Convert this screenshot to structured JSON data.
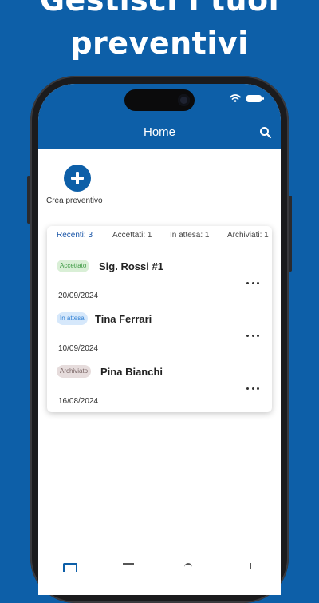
{
  "promo": {
    "line1": "Gestisci i tuoi",
    "line2": "preventivi"
  },
  "app": {
    "title": "Home",
    "brand_color": "#0d5fa8"
  },
  "actions": {
    "create_label": "Crea preventivo"
  },
  "tabs": [
    {
      "label": "Recenti: 3",
      "active": true
    },
    {
      "label": "Accettati: 1",
      "active": false
    },
    {
      "label": "In attesa: 1",
      "active": false
    },
    {
      "label": "Archiviati: 1",
      "active": false
    }
  ],
  "quotes": [
    {
      "status": "Accettato",
      "status_bg": "#d9efd6",
      "status_fg": "#3f9a45",
      "name": "Sig. Rossi #1",
      "date": "20/09/2024"
    },
    {
      "status": "In attesa",
      "status_bg": "#d6e8fb",
      "status_fg": "#2f7fd3",
      "name": "Tina Ferrari",
      "date": "10/09/2024"
    },
    {
      "status": "Archiviato",
      "status_bg": "#e6dcdc",
      "status_fg": "#7a6666",
      "name": "Pina Bianchi",
      "date": "16/08/2024"
    }
  ]
}
